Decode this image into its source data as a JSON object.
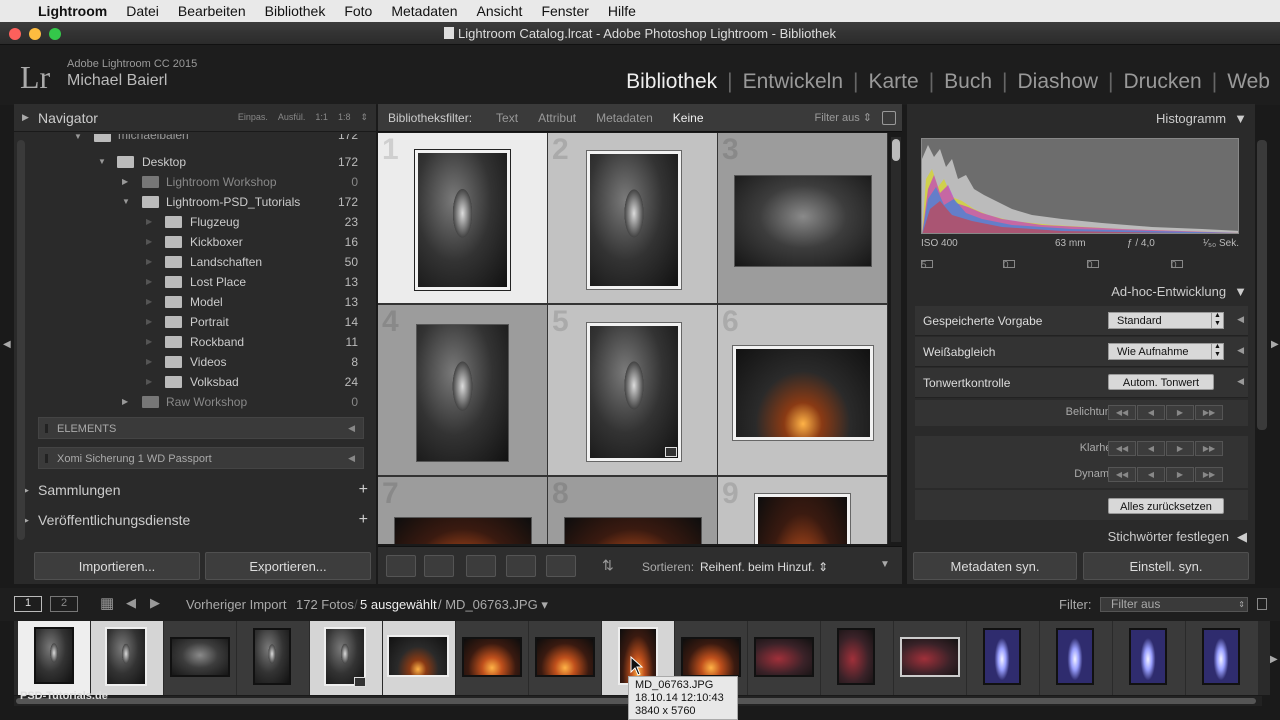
{
  "menubar": {
    "app": "Lightroom",
    "items": [
      "Datei",
      "Bearbeiten",
      "Bibliothek",
      "Foto",
      "Metadaten",
      "Ansicht",
      "Fenster",
      "Hilfe"
    ]
  },
  "window": {
    "title": "Lightroom Catalog.lrcat - Adobe Photoshop Lightroom - Bibliothek"
  },
  "identity": {
    "logo": "Lr",
    "product": "Adobe Lightroom CC 2015",
    "user": "Michael Baierl"
  },
  "modules": [
    "Bibliothek",
    "Entwickeln",
    "Karte",
    "Buch",
    "Diashow",
    "Drucken",
    "Web"
  ],
  "active_module": "Bibliothek",
  "navigator": {
    "title": "Navigator",
    "zoom": [
      "Einpas.",
      "Ausfül.",
      "1:1",
      "1:8"
    ]
  },
  "folders": [
    {
      "name": "michaelbaierl",
      "count": "172"
    },
    {
      "name": "Desktop",
      "count": "172"
    },
    {
      "name": "Lightroom Workshop",
      "count": "0"
    },
    {
      "name": "Lightroom-PSD_Tutorials",
      "count": "172"
    },
    {
      "name": "Flugzeug",
      "count": "23"
    },
    {
      "name": "Kickboxer",
      "count": "16"
    },
    {
      "name": "Landschaften",
      "count": "50"
    },
    {
      "name": "Lost Place",
      "count": "13"
    },
    {
      "name": "Model",
      "count": "13"
    },
    {
      "name": "Portrait",
      "count": "14"
    },
    {
      "name": "Rockband",
      "count": "11"
    },
    {
      "name": "Videos",
      "count": "8"
    },
    {
      "name": "Volksbad",
      "count": "24"
    },
    {
      "name": "Raw Workshop",
      "count": "0"
    }
  ],
  "volumes": [
    "ELEMENTS",
    "Xomi Sicherung 1 WD Passport"
  ],
  "left_sections": [
    "Sammlungen",
    "Veröffentlichungsdienste"
  ],
  "left_buttons": {
    "import": "Importieren...",
    "export": "Exportieren..."
  },
  "filterbar": {
    "label": "Bibliotheksfilter:",
    "filters": [
      "Text",
      "Attribut",
      "Metadaten",
      "Keine"
    ],
    "active": "Keine",
    "filter_status": "Filter aus"
  },
  "grid": {
    "cell_numbers": [
      "1",
      "2",
      "3",
      "4",
      "5",
      "6",
      "7",
      "8",
      "9"
    ]
  },
  "toolbar": {
    "sort_label": "Sortieren:",
    "sort_value": "Reihenf. beim Hinzuf."
  },
  "histogram": {
    "title": "Histogramm",
    "iso": "ISO 400",
    "focal": "63 mm",
    "aperture": "ƒ / 4,0",
    "shutter": "¹⁄₅₀ Sek.",
    "counts": [
      "5",
      "0",
      "0",
      "0"
    ]
  },
  "quick_develop": {
    "title": "Ad-hoc-Entwicklung",
    "preset_label": "Gespeicherte Vorgabe",
    "preset_value": "Standard",
    "wb_label": "Weißabgleich",
    "wb_value": "Wie Aufnahme",
    "tone_label": "Tonwertkontrolle",
    "auto_tone": "Autom. Tonwert",
    "exposure": "Belichtung",
    "clarity": "Klarheit",
    "vibrance": "Dynamik",
    "reset": "Alles zurücksetzen"
  },
  "keywords": {
    "title": "Stichwörter festlegen"
  },
  "right_buttons": {
    "sync_meta": "Metadaten syn.",
    "sync_settings": "Einstell. syn."
  },
  "filmstrip": {
    "monitor1": "1",
    "monitor2": "2",
    "source": "Vorheriger Import",
    "count": "172 Fotos",
    "selected": "5 ausgewählt",
    "file": "/ MD_06763.JPG",
    "filter_label": "Filter:",
    "filter_value": "Filter aus"
  },
  "tooltip": {
    "file": "MD_06763.JPG",
    "date": "18.10.14 12:10:43",
    "dims": "3840 x 5760"
  },
  "watermark": "PSD-Tutorials.de"
}
